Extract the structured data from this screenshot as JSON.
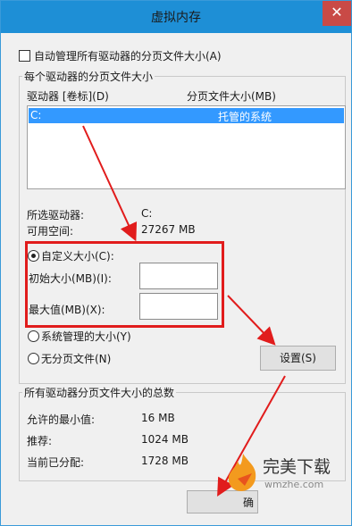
{
  "window": {
    "title": "虚拟内存",
    "close_glyph": "✕"
  },
  "auto_manage": {
    "label": "自动管理所有驱动器的分页文件大小(A)",
    "checked": false
  },
  "drives_group": {
    "title": "每个驱动器的分页文件大小",
    "col_drive": "驱动器 [卷标](D)",
    "col_size": "分页文件大小(MB)",
    "rows": [
      {
        "drive": "C:",
        "size": "托管的系统",
        "selected": true
      }
    ],
    "selected_drive_label": "所选驱动器:",
    "selected_drive_value": "C:",
    "free_space_label": "可用空间:",
    "free_space_value": "27267 MB",
    "custom_size_label": "自定义大小(C):",
    "initial_size_label": "初始大小(MB)(I):",
    "initial_size_value": "",
    "max_size_label": "最大值(MB)(X):",
    "max_size_value": "",
    "system_managed_label": "系统管理的大小(Y)",
    "no_paging_label": "无分页文件(N)",
    "selected_option": "custom",
    "set_button": "设置(S)"
  },
  "totals_group": {
    "title": "所有驱动器分页文件大小的总数",
    "min_label": "允许的最小值:",
    "min_value": "16 MB",
    "recommended_label": "推荐:",
    "recommended_value": "1024 MB",
    "current_label": "当前已分配:",
    "current_value": "1728 MB"
  },
  "ok_button": "确",
  "watermark": {
    "main": "完美下载",
    "sub": "wmzhe.com"
  },
  "colors": {
    "titlebar": "#1e8fd6",
    "selection": "#3399ff",
    "highlight": "#e11c1c",
    "close": "#c94a46"
  }
}
